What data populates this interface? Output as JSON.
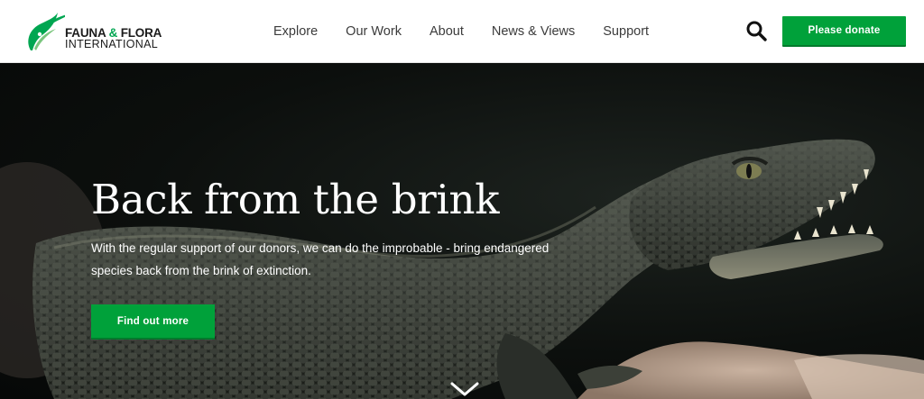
{
  "header": {
    "logo": {
      "line1_a": "FAUNA",
      "line1_amp": "&",
      "line1_b": "FLORA",
      "line2": "INTERNATIONAL",
      "icon": "leaf-bird-logo-icon"
    },
    "nav": [
      {
        "label": "Explore"
      },
      {
        "label": "Our Work"
      },
      {
        "label": "About"
      },
      {
        "label": "News & Views"
      },
      {
        "label": "Support"
      }
    ],
    "search_icon": "search-icon",
    "donate_label": "Please donate"
  },
  "hero": {
    "title": "Back from the brink",
    "text": "With the regular support of our donors, we can do the improbable - bring endangered species back from the brink of extinction.",
    "cta_label": "Find out more",
    "scroll_icon": "chevron-down-icon"
  },
  "colors": {
    "brand_green": "#00a13a",
    "logo_green": "#00a651",
    "header_bg": "#ffffff",
    "hero_bg": "#0c0f0d"
  }
}
